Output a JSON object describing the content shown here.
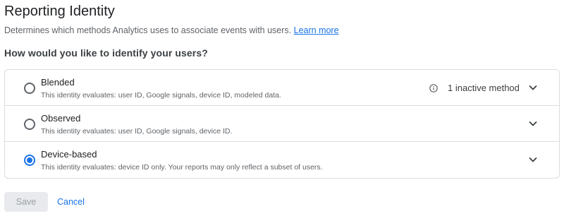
{
  "header": {
    "title": "Reporting Identity",
    "description": "Determines which methods Analytics uses to associate events with users.",
    "learn_more": "Learn more"
  },
  "question": "How would you like to identify your users?",
  "options": [
    {
      "label": "Blended",
      "description": "This identity evaluates: user ID, Google signals, device ID, modeled data.",
      "selected": false,
      "status_text": "1 inactive method",
      "status_icon": "info-icon",
      "expand_icon": "chevron-down-icon"
    },
    {
      "label": "Observed",
      "description": "This identity evaluates: user ID, Google signals, device ID.",
      "selected": false,
      "expand_icon": "chevron-down-icon"
    },
    {
      "label": "Device-based",
      "description": "This identity evaluates: device ID only. Your reports may only reflect a subset of users.",
      "selected": true,
      "expand_icon": "chevron-down-icon"
    }
  ],
  "actions": {
    "save_label": "Save",
    "save_disabled": true,
    "cancel_label": "Cancel"
  },
  "colors": {
    "accent": "#1a73e8",
    "text_primary": "#202124",
    "text_secondary": "#5f6368",
    "border": "#dadce0",
    "disabled_bg": "#e8eaed",
    "disabled_text": "#9aa0a6"
  }
}
